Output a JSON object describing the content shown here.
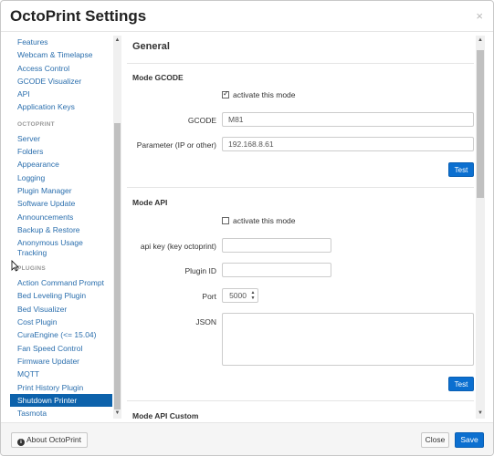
{
  "dialog": {
    "title": "OctoPrint Settings",
    "close_glyph": "×"
  },
  "sidebar": {
    "items_top": [
      "Features",
      "Webcam & Timelapse",
      "Access Control",
      "GCODE Visualizer",
      "API",
      "Application Keys"
    ],
    "octoprint_header": "OCTOPRINT",
    "items_octoprint": [
      "Server",
      "Folders",
      "Appearance",
      "Logging",
      "Plugin Manager",
      "Software Update",
      "Announcements",
      "Backup & Restore"
    ],
    "anonymous_usage": "Anonymous Usage Tracking",
    "plugins_header": "PLUGINS",
    "items_plugins": [
      "Action Command Prompt",
      "Bed Leveling Plugin",
      "Bed Visualizer",
      "Cost Plugin",
      "CuraEngine (<= 15.04)",
      "Fan Speed Control",
      "Firmware Updater",
      "MQTT",
      "Print History Plugin",
      "Shutdown Printer",
      "Tasmota"
    ],
    "active_item": "Shutdown Printer"
  },
  "content": {
    "section_title": "General",
    "mode_gcode": {
      "title": "Mode GCODE",
      "activate_label": "activate this mode",
      "activate_checked": true,
      "gcode_label": "GCODE",
      "gcode_value": "M81",
      "param_label": "Parameter (IP or other)",
      "param_value": "192.168.8.61",
      "test_label": "Test"
    },
    "mode_api": {
      "title": "Mode API",
      "activate_label": "activate this mode",
      "activate_checked": false,
      "apikey_label": "api key (key octoprint)",
      "apikey_value": "",
      "pluginid_label": "Plugin ID",
      "pluginid_value": "",
      "port_label": "Port",
      "port_value": "5000",
      "json_label": "JSON",
      "json_value": "",
      "test_label": "Test"
    },
    "next_section_partial": "Mode API Custom"
  },
  "footer": {
    "about_label": "About OctoPrint",
    "close_label": "Close",
    "save_label": "Save"
  },
  "colors": {
    "primary": "#0b6fd0",
    "link": "#2a6ead",
    "active_bg": "#0d62ab"
  }
}
